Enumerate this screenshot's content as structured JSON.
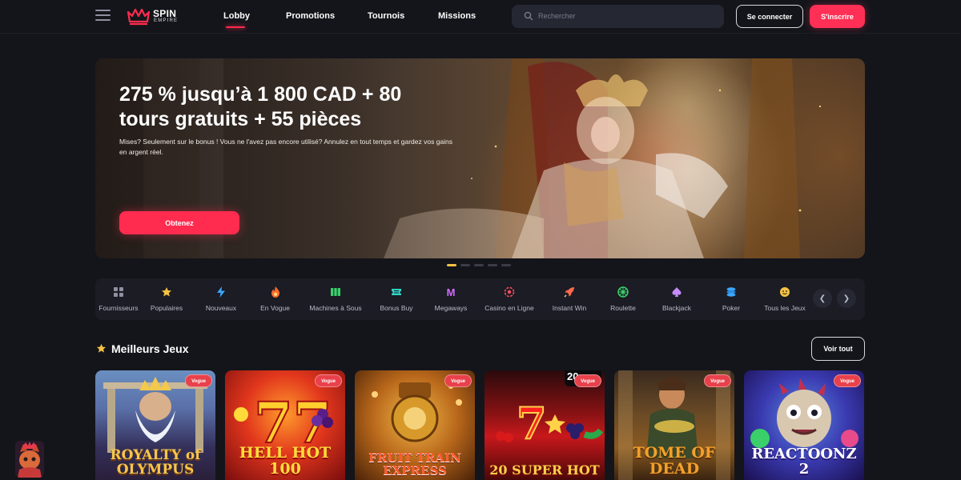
{
  "colors": {
    "accent": "#ff2f55",
    "background": "#14151b",
    "panel": "#1b1c24",
    "badge": "#e8414b"
  },
  "header": {
    "menu_icon": "hamburger-menu-icon",
    "logo": {
      "line1": "SPIN",
      "line2": "EMPIRE"
    },
    "nav": [
      {
        "label": "Lobby",
        "active": true
      },
      {
        "label": "Promotions"
      },
      {
        "label": "Tournois"
      },
      {
        "label": "Missions"
      }
    ],
    "search": {
      "placeholder": "Rechercher",
      "value": ""
    },
    "login_label": "Se connecter",
    "signup_label": "S'inscrire"
  },
  "hero": {
    "title": "275 % jusqu’à 1 800 CAD + 80 tours gratuits + 55 pièces",
    "description": "Mises? Seulement sur le bonus ! Vous ne l'avez pas encore utilisé? Annulez en tout temps et gardez vos gains en argent réel.",
    "cta_label": "Obtenez",
    "slides": 5,
    "active_slide": 1
  },
  "categories": [
    {
      "label": "Fournisseurs",
      "icon": "grid-icon",
      "color": "#8e90a0"
    },
    {
      "label": "Populaires",
      "icon": "star-icon",
      "color": "#f5c242"
    },
    {
      "label": "Nouveaux",
      "icon": "lightning-icon",
      "color": "#3aa7ff"
    },
    {
      "label": "En Vogue",
      "icon": "flame-icon",
      "color": "#ff6a2c"
    },
    {
      "label": "Machines à Sous",
      "icon": "slot-reels-icon",
      "color": "#3ccf6b"
    },
    {
      "label": "Bonus Buy",
      "icon": "ticket-icon",
      "color": "#2ed3c5"
    },
    {
      "label": "Megaways",
      "icon": "letter-m-icon",
      "color": "#d26bff"
    },
    {
      "label": "Casino en Ligne",
      "icon": "target-icon",
      "color": "#ff4d5e"
    },
    {
      "label": "Instant Win",
      "icon": "rocket-icon",
      "color": "#ff6a4d"
    },
    {
      "label": "Roulette",
      "icon": "roulette-icon",
      "color": "#3ccf6b"
    },
    {
      "label": "Blackjack",
      "icon": "spade-icon",
      "color": "#c68bff"
    },
    {
      "label": "Poker",
      "icon": "chips-icon",
      "color": "#3aa7ff"
    },
    {
      "label": "Tous les Jeux",
      "icon": "smiley-icon",
      "color": "#f5c242"
    }
  ],
  "section": {
    "title": "Meilleurs Jeux",
    "see_all_label": "Voir tout"
  },
  "games": [
    {
      "title": "ROYALTY of OLYMPUS",
      "badge": "Vogue"
    },
    {
      "title": "HELL HOT 100",
      "badge": "Vogue"
    },
    {
      "title": "FRUIT TRAIN EXPRESS",
      "badge": "Vogue"
    },
    {
      "title": "20 SUPER HOT",
      "badge": "Vogue",
      "corner": "20"
    },
    {
      "title": "TOME OF DEAD",
      "badge": "Vogue"
    },
    {
      "title": "REACTOONZ 2",
      "badge": "Vogue"
    }
  ]
}
